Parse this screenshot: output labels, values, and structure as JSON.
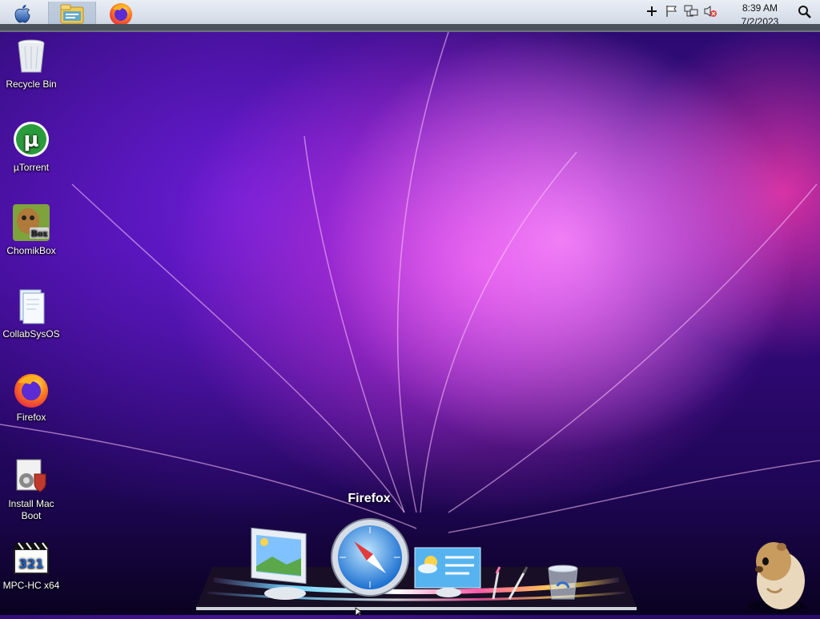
{
  "menubar": {
    "apple_icon": "apple-icon",
    "pinned": [
      {
        "name": "file-explorer",
        "icon": "folder-icon"
      },
      {
        "name": "firefox",
        "icon": "firefox-icon"
      }
    ],
    "tray_icons": [
      "plus-icon",
      "flag-icon",
      "network-icon",
      "speaker-muted-icon"
    ],
    "clock": {
      "time": "8:39 AM",
      "date": "7/2/2023"
    },
    "search_icon": "search-icon"
  },
  "desktop_icons": [
    {
      "label": "Recycle Bin",
      "icon": "recycle-bin-icon"
    },
    {
      "label": "µTorrent",
      "icon": "utorrent-icon"
    },
    {
      "label": "ChomikBox",
      "icon": "chomikbox-icon"
    },
    {
      "label": "CollabSysOS",
      "icon": "document-icon"
    },
    {
      "label": "Firefox",
      "icon": "firefox-icon"
    },
    {
      "label": "Install Mac Boot",
      "icon": "installer-icon"
    },
    {
      "label": "MPC-HC x64",
      "icon": "media-player-icon"
    }
  ],
  "dock": {
    "hover_label": "Firefox",
    "items": [
      "monitor-picture-icon",
      "safari-compass-icon",
      "weather-widget-icon",
      "pen-tools-icon",
      "trash-icon"
    ]
  },
  "colors": {
    "menubar_bg": "#d4dce8",
    "wallpaper_accent": "#e040e0"
  }
}
